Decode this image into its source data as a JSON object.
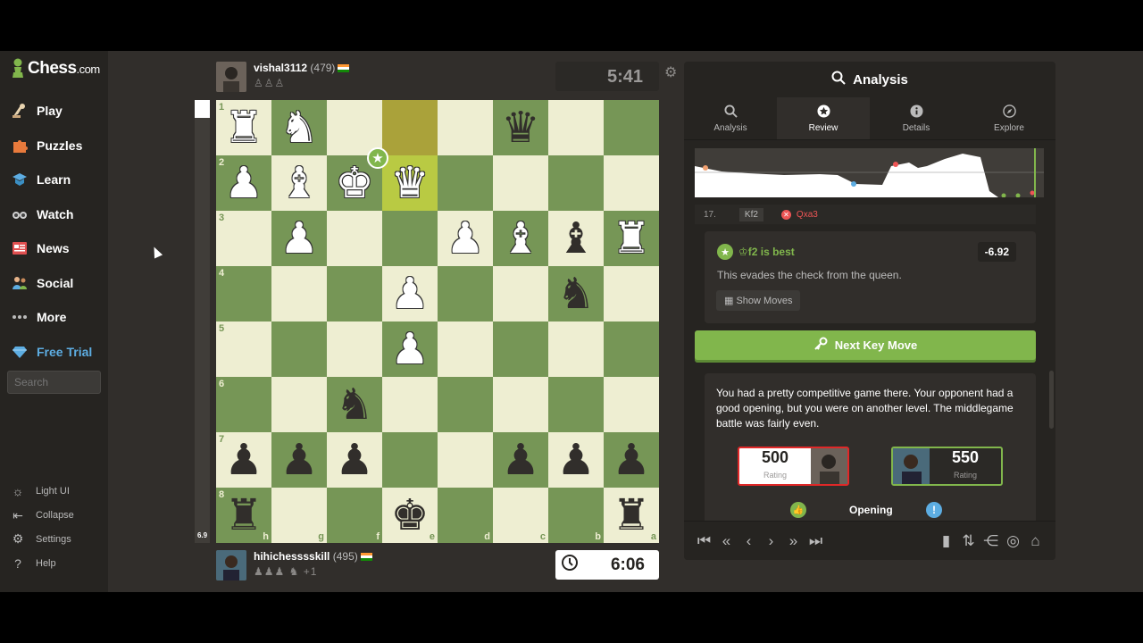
{
  "logo": {
    "name": "Chess",
    "tld": ".com"
  },
  "nav": [
    {
      "label": "Play",
      "icon": "play-icon"
    },
    {
      "label": "Puzzles",
      "icon": "puzzle-icon"
    },
    {
      "label": "Learn",
      "icon": "learn-icon"
    },
    {
      "label": "Watch",
      "icon": "watch-icon"
    },
    {
      "label": "News",
      "icon": "news-icon"
    },
    {
      "label": "Social",
      "icon": "social-icon"
    },
    {
      "label": "More",
      "icon": "more-icon"
    },
    {
      "label": "Free Trial",
      "icon": "diamond-icon"
    }
  ],
  "search": {
    "placeholder": "Search"
  },
  "bottom_nav": [
    {
      "label": "Light UI",
      "icon": "sun-icon"
    },
    {
      "label": "Collapse",
      "icon": "collapse-icon"
    },
    {
      "label": "Settings",
      "icon": "gear-icon"
    },
    {
      "label": "Help",
      "icon": "help-icon"
    }
  ],
  "top_player": {
    "name": "vishal3112",
    "rating": "(479)",
    "captured": "♙♙♙"
  },
  "bottom_player": {
    "name": "hihichesssskill",
    "rating": "(495)",
    "captured": "♟♟♟ ♞",
    "advantage": "+1"
  },
  "top_clock": "5:41",
  "bottom_clock": "6:06",
  "eval_bar": {
    "value": "6.9",
    "white_fraction": 0.04
  },
  "board": {
    "ranks": [
      "1",
      "2",
      "3",
      "4",
      "5",
      "6",
      "7",
      "8"
    ],
    "files": [
      "h",
      "g",
      "f",
      "e",
      "d",
      "c",
      "b",
      "a"
    ],
    "pieces": [
      {
        "sq": "h1",
        "p": "♜",
        "c": "w"
      },
      {
        "sq": "g1",
        "p": "♞",
        "c": "w"
      },
      {
        "sq": "c1",
        "p": "♛",
        "c": "b"
      },
      {
        "sq": "h2",
        "p": "♟",
        "c": "w"
      },
      {
        "sq": "g2",
        "p": "♝",
        "c": "w"
      },
      {
        "sq": "f2",
        "p": "♚",
        "c": "w"
      },
      {
        "sq": "e2",
        "p": "♛",
        "c": "w"
      },
      {
        "sq": "g3",
        "p": "♟",
        "c": "w"
      },
      {
        "sq": "d3",
        "p": "♟",
        "c": "w"
      },
      {
        "sq": "c3",
        "p": "♝",
        "c": "w"
      },
      {
        "sq": "b3",
        "p": "♝",
        "c": "b"
      },
      {
        "sq": "a3",
        "p": "♜",
        "c": "w"
      },
      {
        "sq": "e4",
        "p": "♟",
        "c": "w"
      },
      {
        "sq": "b4",
        "p": "♞",
        "c": "b"
      },
      {
        "sq": "e5",
        "p": "♟",
        "c": "w"
      },
      {
        "sq": "f6",
        "p": "♞",
        "c": "b"
      },
      {
        "sq": "h7",
        "p": "♟",
        "c": "b"
      },
      {
        "sq": "g7",
        "p": "♟",
        "c": "b"
      },
      {
        "sq": "f7",
        "p": "♟",
        "c": "b"
      },
      {
        "sq": "c7",
        "p": "♟",
        "c": "b"
      },
      {
        "sq": "b7",
        "p": "♟",
        "c": "b"
      },
      {
        "sq": "a7",
        "p": "♟",
        "c": "b"
      },
      {
        "sq": "h8",
        "p": "♜",
        "c": "b"
      },
      {
        "sq": "e8",
        "p": "♚",
        "c": "b"
      },
      {
        "sq": "a8",
        "p": "♜",
        "c": "b"
      }
    ],
    "highlights": [
      "e1",
      "e2"
    ]
  },
  "panel": {
    "title": "Analysis",
    "tabs": [
      {
        "label": "Analysis",
        "icon": "search-icon"
      },
      {
        "label": "Review",
        "icon": "star-icon"
      },
      {
        "label": "Details",
        "icon": "info-icon"
      },
      {
        "label": "Explore",
        "icon": "compass-icon"
      }
    ],
    "active_tab": "Review",
    "move_row": {
      "number": "17.",
      "white": "Kf2",
      "black": "Qxa3"
    },
    "best": {
      "title": "♔f2 is best",
      "eval": "-6.92",
      "desc": "This evades the check from the queen.",
      "show_moves": "Show Moves"
    },
    "next_key": "Next Key Move",
    "summary": "You had a pretty competitive game there. Your opponent had a good opening, but you were on another level. The middlegame battle was fairly even.",
    "ratings": {
      "me": "500",
      "opp": "550",
      "label": "Rating"
    },
    "phase": {
      "label": "Opening"
    }
  },
  "colors": {
    "accent": "#81b64c",
    "light_square": "#eeeed2",
    "dark_square": "#769656",
    "blunder": "#e55555"
  }
}
